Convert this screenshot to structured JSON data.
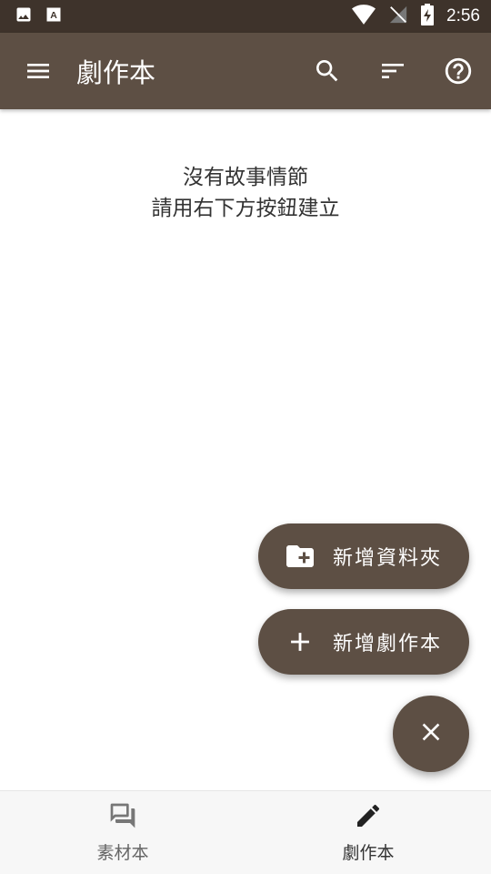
{
  "status_bar": {
    "time": "2:56",
    "left_icons": [
      "image-icon",
      "a-box-icon"
    ],
    "right_icons": [
      "wifi-icon",
      "no-signal-icon",
      "battery-charging-icon"
    ]
  },
  "app_bar": {
    "title": "劇作本",
    "menu_icon": "menu-icon",
    "actions": [
      "search-icon",
      "sort-icon",
      "help-icon"
    ],
    "color": "#5d4f44"
  },
  "empty_state": {
    "line1": "沒有故事情節",
    "line2": "請用右下方按鈕建立"
  },
  "fab_menu": {
    "new_folder_label": "新增資料夾",
    "new_script_label": "新增劇作本",
    "close_icon": "close-icon"
  },
  "bottom_nav": {
    "items": [
      {
        "label": "素材本",
        "icon": "forum-icon",
        "active": false
      },
      {
        "label": "劇作本",
        "icon": "pencil-icon",
        "active": true
      }
    ]
  }
}
